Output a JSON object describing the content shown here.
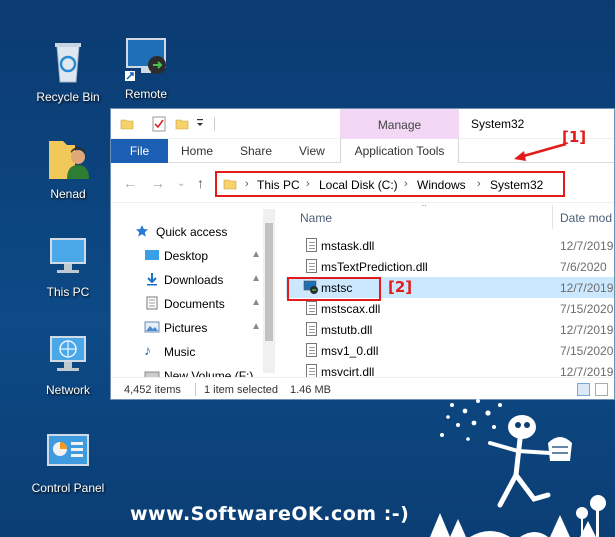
{
  "desktop": {
    "icons": [
      {
        "label": "Recycle Bin"
      },
      {
        "label": "Remote"
      },
      {
        "label": "Nenad"
      },
      {
        "label": "This PC"
      },
      {
        "label": "Network"
      },
      {
        "label": "Control Panel"
      }
    ]
  },
  "explorer": {
    "title": "System32",
    "contextual_group": "Manage",
    "ribbon_tabs": {
      "file": "File",
      "home": "Home",
      "share": "Share",
      "view": "View",
      "app_tools": "Application Tools"
    },
    "address": {
      "segments": [
        "This PC",
        "Local Disk (C:)",
        "Windows",
        "System32"
      ],
      "separator": "›"
    },
    "sidebar": [
      {
        "label": "Quick access",
        "icon": "star-icon"
      },
      {
        "label": "Desktop",
        "icon": "desktop-folder-icon"
      },
      {
        "label": "Downloads",
        "icon": "download-icon"
      },
      {
        "label": "Documents",
        "icon": "documents-icon"
      },
      {
        "label": "Pictures",
        "icon": "pictures-icon"
      },
      {
        "label": "Music",
        "icon": "music-icon"
      },
      {
        "label": "New Volume (F:)",
        "icon": "drive-icon"
      }
    ],
    "column_headers": {
      "name": "Name",
      "date": "Date mod"
    },
    "files": [
      {
        "name": "mstask.dll",
        "date": "12/7/2019"
      },
      {
        "name": "msTextPrediction.dll",
        "date": "7/6/2020"
      },
      {
        "name": "mstsc",
        "date": "12/7/2019",
        "selected": true
      },
      {
        "name": "mstscax.dll",
        "date": "7/15/2020"
      },
      {
        "name": "mstutb.dll",
        "date": "12/7/2019"
      },
      {
        "name": "msv1_0.dll",
        "date": "7/15/2020"
      },
      {
        "name": "msvcirt.dll",
        "date": "12/7/2019"
      }
    ],
    "status": {
      "items": "4,452 items",
      "selected": "1 item selected",
      "size": "1.46 MB"
    }
  },
  "annotations": {
    "one": "[1]",
    "two": "[2]",
    "accent": "#e31b1b"
  },
  "watermark": "www.SoftwareOK.com :-)"
}
